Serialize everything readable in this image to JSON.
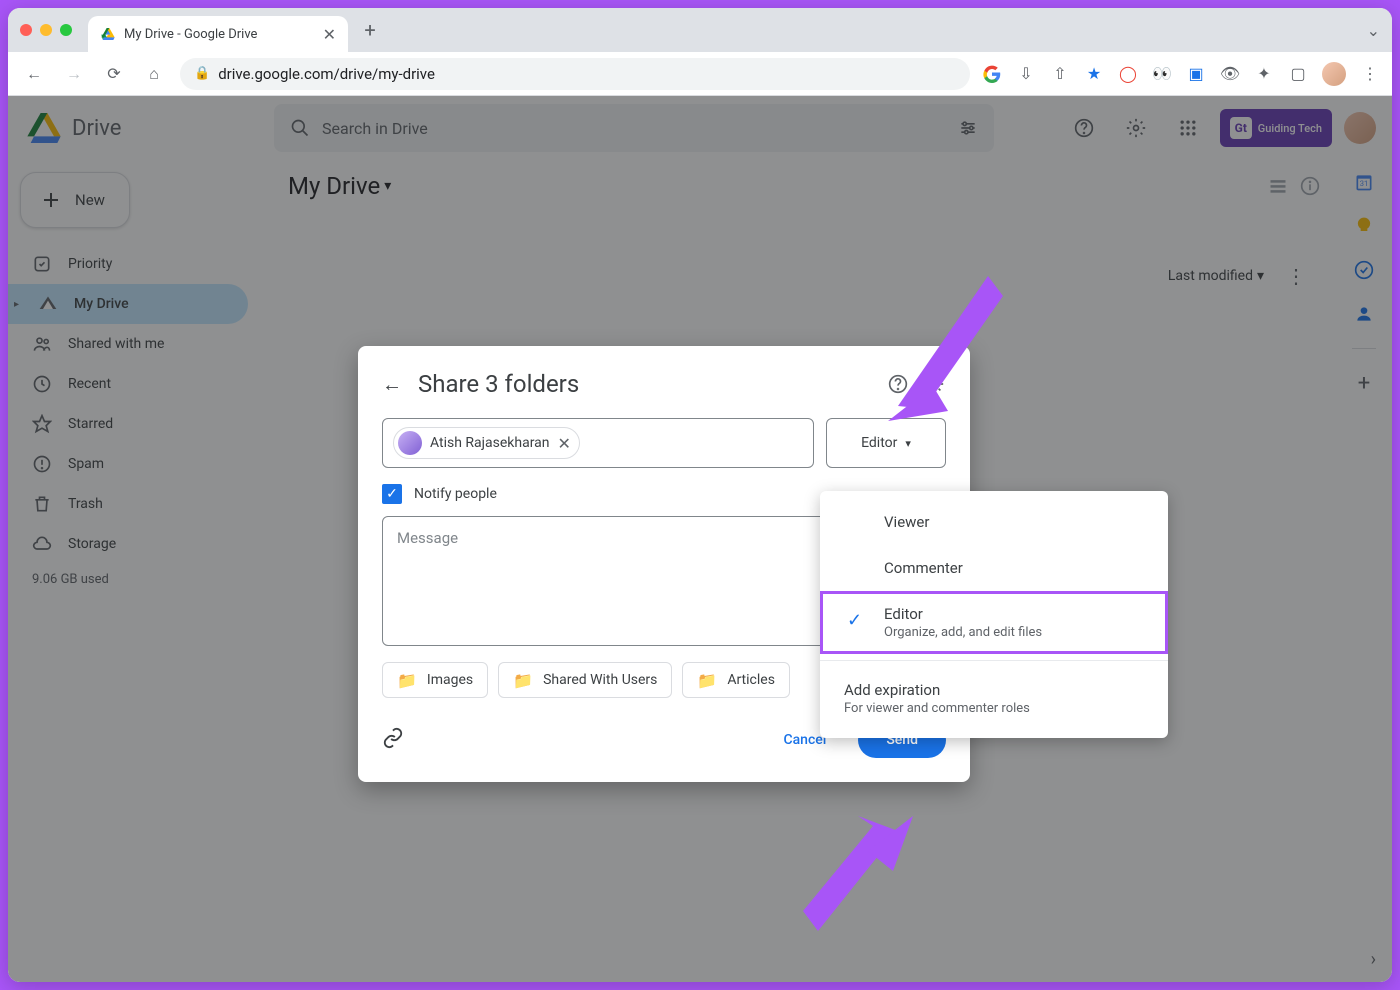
{
  "browser": {
    "tab_title": "My Drive - Google Drive",
    "url": "drive.google.com/drive/my-drive"
  },
  "header": {
    "app_name": "Drive",
    "search_placeholder": "Search in Drive",
    "gt_badge": "Guiding Tech"
  },
  "sidebar": {
    "new_label": "New",
    "items": [
      {
        "label": "Priority"
      },
      {
        "label": "My Drive"
      },
      {
        "label": "Shared with me"
      },
      {
        "label": "Recent"
      },
      {
        "label": "Starred"
      },
      {
        "label": "Spam"
      },
      {
        "label": "Trash"
      },
      {
        "label": "Storage"
      }
    ],
    "storage_used": "9.06 GB used"
  },
  "main": {
    "breadcrumb": "My Drive",
    "sort_label": "Last modified"
  },
  "modal": {
    "title": "Share 3 folders",
    "recipient_chip": "Atish Rajasekharan",
    "role_selected": "Editor",
    "notify_label": "Notify people",
    "message_placeholder": "Message",
    "folders": [
      "Images",
      "Shared With Users",
      "Articles"
    ],
    "cancel_label": "Cancel",
    "send_label": "Send"
  },
  "role_menu": {
    "options": [
      {
        "label": "Viewer",
        "sub": ""
      },
      {
        "label": "Commenter",
        "sub": ""
      },
      {
        "label": "Editor",
        "sub": "Organize, add, and edit files"
      }
    ],
    "expiration_label": "Add expiration",
    "expiration_sub": "For viewer and commenter roles"
  }
}
